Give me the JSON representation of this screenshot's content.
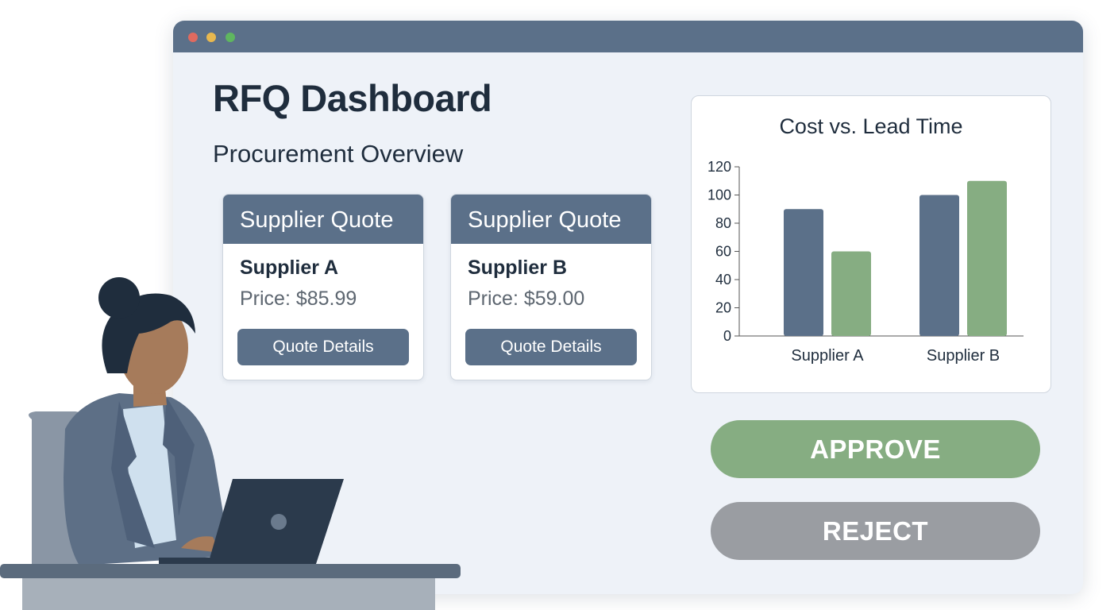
{
  "dashboard": {
    "title": "RFQ Dashboard",
    "subtitle": "Procurement Overview"
  },
  "quotes": [
    {
      "header": "Supplier Quote",
      "supplier": "Supplier A",
      "price": "Price: $85.99",
      "button": "Quote Details"
    },
    {
      "header": "Supplier Quote",
      "supplier": "Supplier B",
      "price": "Price: $59.00",
      "button": "Quote Details"
    }
  ],
  "actions": {
    "approve": "APPROVE",
    "reject": "REJECT"
  },
  "colors": {
    "primary": "#5b7089",
    "approve": "#86ad82",
    "reject": "#9a9da2",
    "series_a": "#5b7089",
    "series_b": "#86ad82"
  },
  "icons": {
    "window_controls": [
      "red-dot-icon",
      "yellow-dot-icon",
      "green-dot-icon"
    ],
    "illustration": "person-at-laptop-illustration"
  },
  "chart_data": {
    "type": "bar",
    "title": "Cost vs. Lead Time",
    "categories": [
      "Supplier A",
      "Supplier B"
    ],
    "series": [
      {
        "values": [
          90,
          100
        ],
        "color": "#5b7089"
      },
      {
        "values": [
          60,
          110
        ],
        "color": "#86ad82"
      }
    ],
    "ylim": [
      0,
      120
    ],
    "yticks": [
      0,
      20,
      40,
      60,
      80,
      100,
      120
    ],
    "grid": false,
    "legend": "none"
  }
}
